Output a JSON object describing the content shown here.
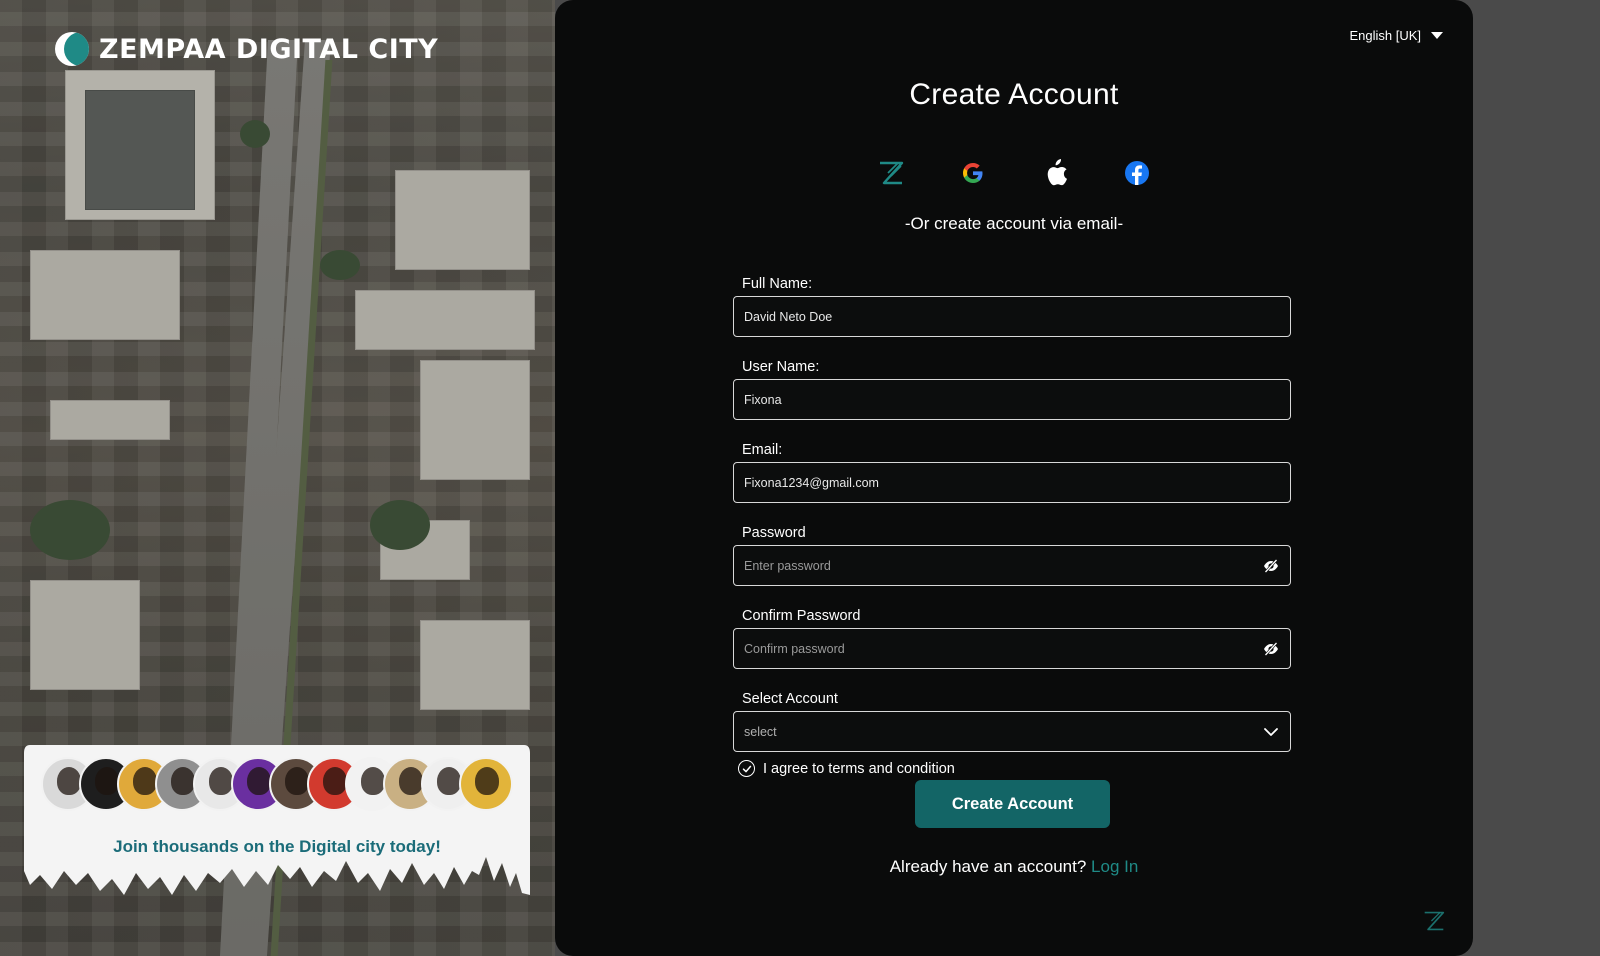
{
  "brand": {
    "name": "ZEMPAA  DIGITAL CITY"
  },
  "join": {
    "text": "Join thousands on the Digital city today!"
  },
  "language": {
    "label": "English [UK]"
  },
  "form": {
    "title": "Create Account",
    "or_text": "-Or create account via email-",
    "full_name": {
      "label": "Full Name:",
      "value": "David Neto Doe"
    },
    "user_name": {
      "label": "User Name:",
      "value": "Fixona"
    },
    "email": {
      "label": "Email:",
      "value": "Fixona1234@gmail.com"
    },
    "password": {
      "label": "Password",
      "placeholder": "Enter password"
    },
    "confirm_password": {
      "label": "Confirm Password",
      "placeholder": "Confirm password"
    },
    "select_account": {
      "label": "Select Account",
      "value": "select"
    },
    "agree_text": "I agree to terms and condition",
    "submit_label": "Create Account",
    "already_text": "Already have an account?",
    "login_label": "Log In"
  },
  "socials": [
    "zempaa-icon",
    "google-icon",
    "apple-icon",
    "facebook-icon"
  ],
  "colors": {
    "accent": "#136566",
    "link": "#1f8a86",
    "panel_bg": "#0a0b0b",
    "join_text": "#1b6c79"
  }
}
